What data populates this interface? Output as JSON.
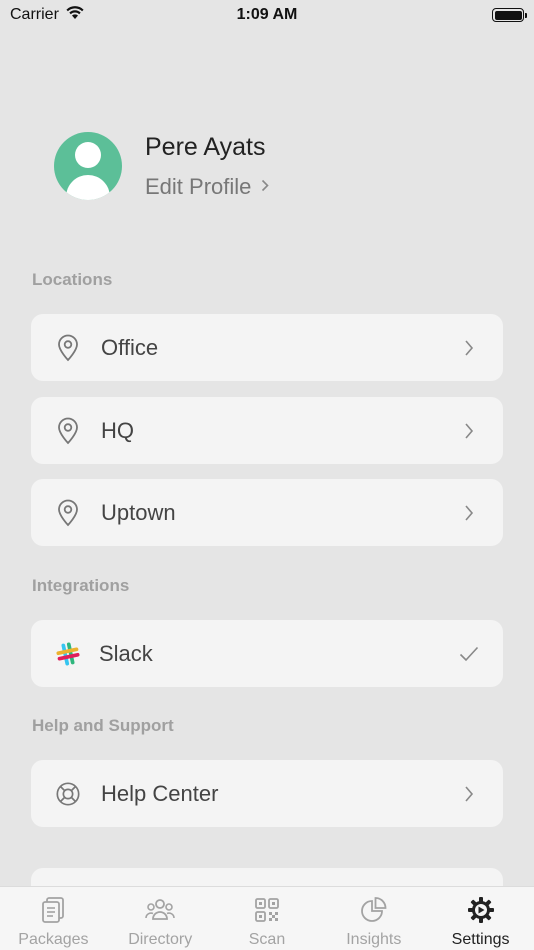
{
  "status": {
    "carrier": "Carrier",
    "time": "1:09 AM"
  },
  "profile": {
    "name": "Pere Ayats",
    "edit_label": "Edit Profile",
    "avatar_color": "#5cbf98"
  },
  "sections": {
    "locations": {
      "title": "Locations",
      "items": [
        {
          "label": "Office",
          "icon": "location-pin-icon"
        },
        {
          "label": "HQ",
          "icon": "location-pin-icon"
        },
        {
          "label": "Uptown",
          "icon": "location-pin-icon"
        }
      ]
    },
    "integrations": {
      "title": "Integrations",
      "items": [
        {
          "label": "Slack",
          "icon": "slack-icon",
          "connected": true
        }
      ]
    },
    "help": {
      "title": "Help and Support",
      "items": [
        {
          "label": "Help Center",
          "icon": "lifebuoy-icon"
        }
      ]
    }
  },
  "tabbar": {
    "tabs": [
      {
        "label": "Packages",
        "icon": "packages-icon",
        "active": false
      },
      {
        "label": "Directory",
        "icon": "directory-icon",
        "active": false
      },
      {
        "label": "Scan",
        "icon": "qr-code-icon",
        "active": false
      },
      {
        "label": "Insights",
        "icon": "pie-chart-icon",
        "active": false
      },
      {
        "label": "Settings",
        "icon": "gear-icon",
        "active": true
      }
    ]
  }
}
